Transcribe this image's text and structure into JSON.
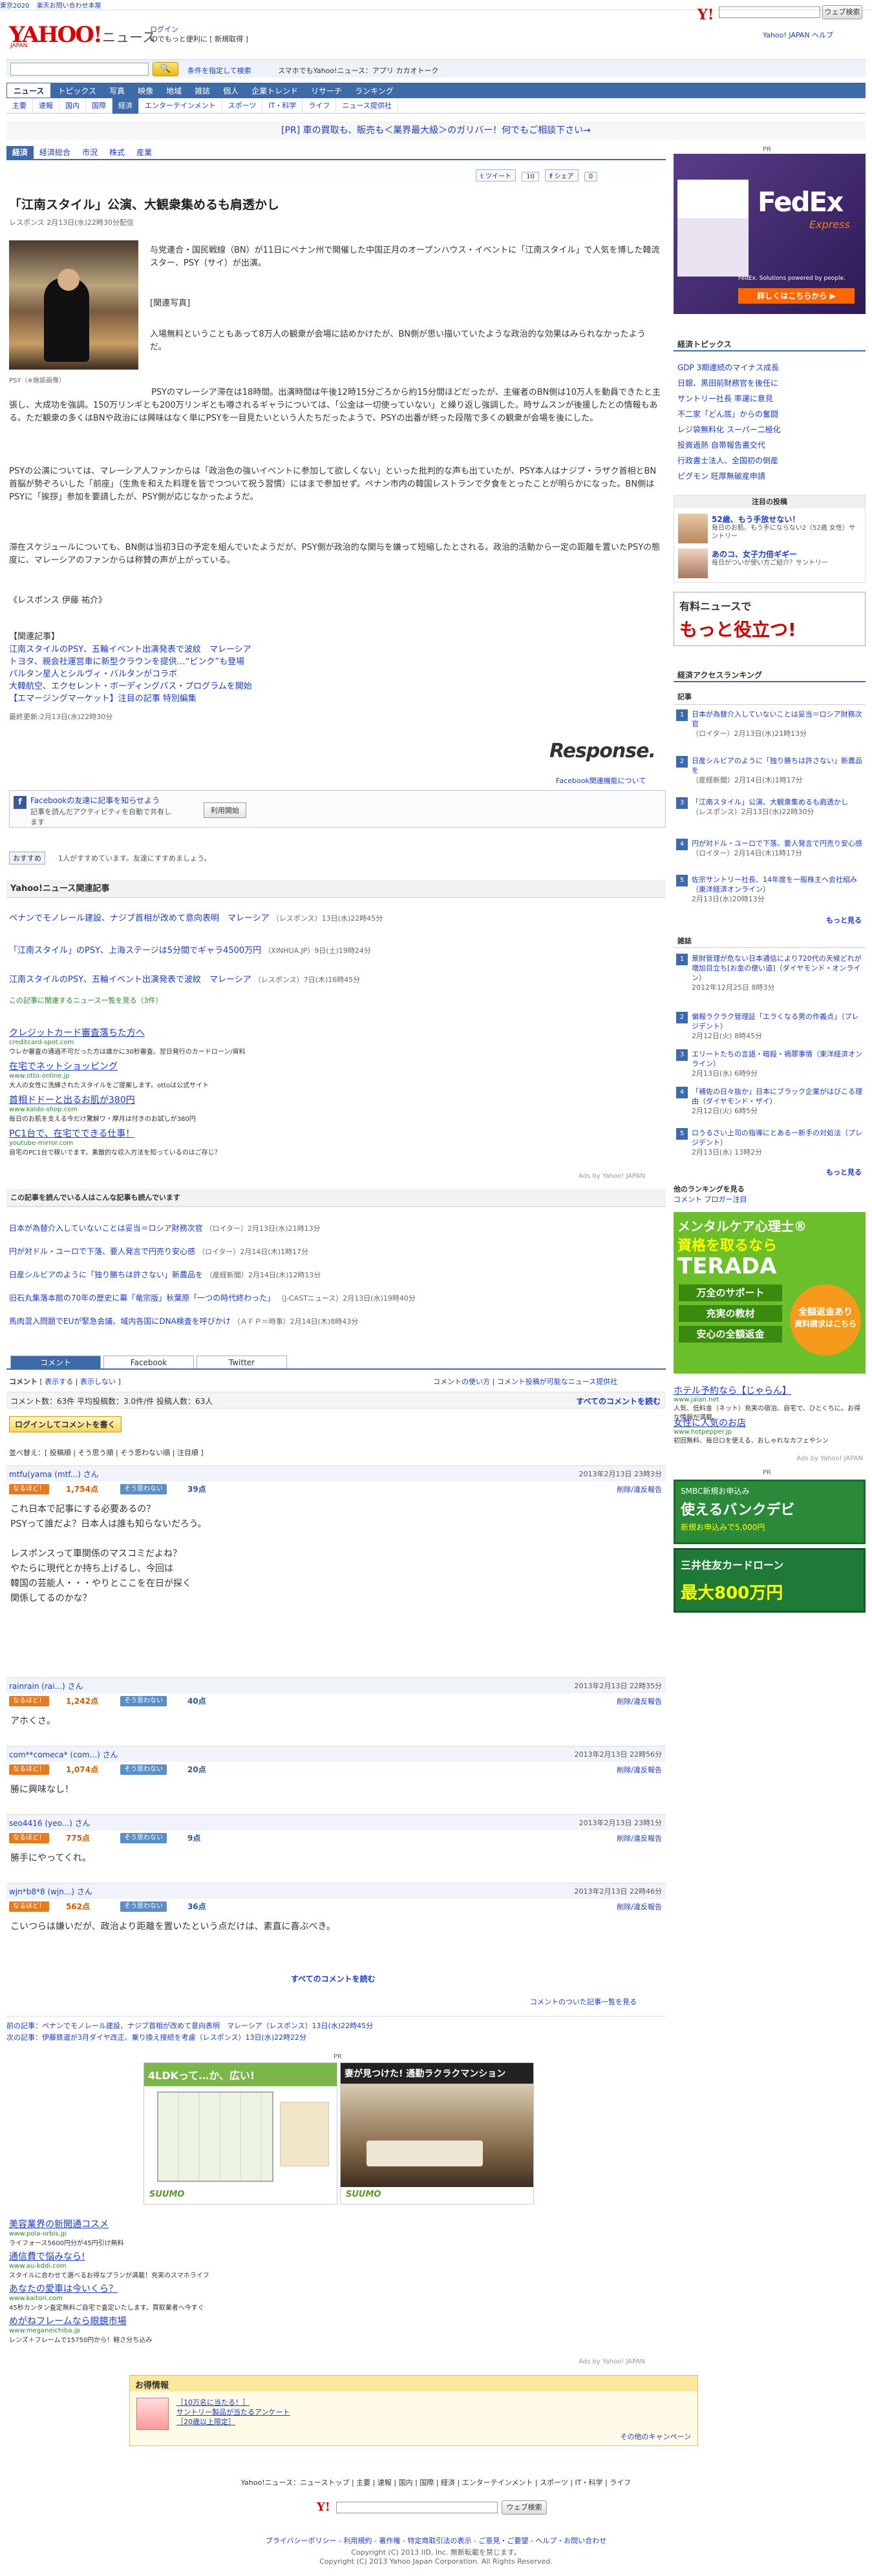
{
  "topbar": {
    "items": [
      "東京2020",
      "楽天お問い合わせ本屋",
      "ヤフオク!"
    ]
  },
  "header": {
    "logo": "YAHOO!",
    "logo_sub": "JAPAN",
    "section": "ニュース",
    "login": "ログイン",
    "login_sub": "IDでもっと便利に [ 新規取得 ]",
    "top_search_btn": "ウェブ検索",
    "top_links": "Yahoo! JAPAN ヘルプ"
  },
  "search": {
    "placeholder": "",
    "button": "🔍",
    "cond": "条件を指定して検索",
    "mobile": "スマホでもYahoo!ニュース：アプリ  カカオトーク"
  },
  "nav1": [
    "ニュース",
    "トピックス",
    "写真",
    "映像",
    "地域",
    "雑誌",
    "個人",
    "企業トレンド",
    "リサーチ",
    "ランキング"
  ],
  "nav2": [
    "主要",
    "速報",
    "国内",
    "国際",
    "経済",
    "エンターテインメント",
    "スポーツ",
    "IT・科学",
    "ライフ",
    "ニュース提供社"
  ],
  "pr_top": "[PR] 車の買取も、販売も＜業界最大級＞のガリバー！何でもご相談下さい→",
  "subnav": [
    "経済",
    "経済総合",
    "市況",
    "株式",
    "産業"
  ],
  "share": {
    "tweet": "ツイート",
    "tweet_count": "10",
    "fb": "シェア",
    "bookmark": "0"
  },
  "article": {
    "title": "「江南スタイル」公演、大観衆集めるも肩透かし",
    "meta": "レスポンス 2月13日(水)22時30分配信",
    "photo_caption": "PSY（※施設画像）",
    "p1": "与党連合・国民戦線（BN）が11日にペナン州で開催した中国正月のオープンハウス・イベントに「江南スタイル」で人気を博した韓流スター、PSY（サイ）が出演。",
    "related_photo": "[関連写真]",
    "p2": "入場無料ということもあって8万人の観衆が会場に詰めかけたが、BN側が思い描いていたような政治的な効果はみられなかったようだ。",
    "p3": "PSYのマレーシア滞在は18時間。出演時間は午後12時15分ごろから約15分間ほどだったが、主催者のBN側は10万人を動員できたと主張し、大成功を強調。150万リンギとも200万リンギとも噂されるギャラについては、「公金は一切使っていない」と繰り返し強調した。時サムスンが後援したとの情報もある。ただ観衆の多くはBNや政治には興味はなく単にPSYを一目見たいという人たちだったようで、PSYの出番が終った段階で多くの観衆が会場を後にした。",
    "p4": "PSYの公演については、マレーシア人ファンからは「政治色の強いイベントに参加して欲しくない」といった批判的な声も出ていたが、PSY本人はナジブ・ラザク首相とBN首脳が勢ぞろいした「前座」（生魚を和えた料理を皆でつついて祝う習慣）にはまで参加せず。ペナン市内の韓国レストランで夕食をとったことが明らかになった。BN側はPSYに「挨拶」参加を要請したが、PSY側が応じなかったようだ。",
    "p5": "滞在スケジュールについても、BN側は当初3日の予定を組んでいたようだが、PSY側が政治的な関与を嫌って短縮したとされる。政治的活動から一定の距離を置いたPSYの態度に、マレーシアのファンからは称賛の声が上がっている。",
    "author": "《レスポンス 伊藤 祐介》",
    "rel_head": "【関連記事】",
    "rel_links": [
      "江南スタイルのPSY、五輪イベント出演発表で波紋　マレーシア",
      "トヨタ、親会社運営車に新型クラウンを提供…“ピンク”も登場",
      "パルタン星人とシルヴィ・バルタンがコラボ",
      "大韓航空、エクセレント・ボーディングパス・プログラムを開始",
      "【エマージングマーケット】注目の記事 特別編集"
    ],
    "updated": "最終更新:2月13日(水)22時30分",
    "source_logo": "Response.",
    "fb_guide": "Facebook関連機能について",
    "fb_text": "Facebookの友達に記事を知らせよう",
    "fb_sub": "記事を読んだアクティビティを自動で共有します",
    "fb_btn": "利用開始",
    "like": "おすすめ",
    "like_note": "1人がすすめています。友達にすすめましょう。"
  },
  "related": {
    "head": "Yahoo!ニュース関連記事",
    "items": [
      {
        "t": "ペナンでモノレール建設、ナジブ首相が改めて意向表明　マレーシア",
        "s": "（レスポンス）13日(水)22時45分"
      },
      {
        "t": "「江南スタイル」のPSY、上海ステージは5分間でギャラ4500万円",
        "s": "（XINHUA.JP）9日(土)19時24分"
      },
      {
        "t": "江南スタイルのPSY、五輪イベント出演発表で波紋　マレーシア",
        "s": "（レスポンス）7日(木)16時45分"
      }
    ],
    "more": "この記事に関連するニュース一覧を見る（3件）"
  },
  "ads1": [
    {
      "t": "クレジットカード審査落ちた方へ",
      "u": "creditcard-spot.com",
      "d": "ウレか審査の通過不可だった方は誰かに30秒審査。翌日発行のカードローン/資料"
    },
    {
      "t": "在宅でネットショッピング",
      "u": "www.otto-online.jp",
      "d": "大人の女性に洗練されたスタイルをご提案します。ottoは公式サイト"
    },
    {
      "t": "首相ドドーと出るお肌が380円",
      "u": "www.kaldo-shop.com",
      "d": "毎日のお肌を支える今だけ驚解ワ・摩月は付きのお試しが380円"
    },
    {
      "t": "PC1台で、在宅でできる仕事！",
      "u": "youtube-mirror.com",
      "d": "自宅のPC1台で稼いでます。素敵的な収入方法を知っているのはご存じ？"
    }
  ],
  "ads1_label": "Ads by Yahoo! JAPAN",
  "others": {
    "head": "この記事を読んでいる人はこんな記事も読んでいます",
    "items": [
      {
        "t": "日本が為替介入していないことは妥当＝ロシア財務次官",
        "s": "（ロイター）2月13日(水)21時13分"
      },
      {
        "t": "円が対ドル・ユーロで下落、要人発言で円売り安心感",
        "s": "（ロイター）2月14日(木)1時17分"
      },
      {
        "t": "日産シルビアのように「独り勝ちは許さない」新農品を",
        "s": "（産経新聞）2月14日(木)12時13分"
      },
      {
        "t": "旧石丸集落本館の70年の歴史に幕「竜宗版」秋葉原「一つの時代終わった」",
        "s": "（J-CASTニュース）2月13日(水)19時40分"
      },
      {
        "t": "馬肉混入問題でEUが緊急会議、域内各国にDNA検査を呼びかけ",
        "s": "（ＡＦＰ＝時事）2月14日(木)8時43分"
      }
    ]
  },
  "tabs": [
    "コメント",
    "Facebook",
    "Twitter"
  ],
  "comments_bar": {
    "label": "コメント",
    "show": "表示する",
    "hide": "表示しない",
    "policy": "コメントの使い方",
    "policy2": "コメント投稿が可能なニュース提供社"
  },
  "stats": {
    "text": "コメント数：63件  平均投稿数：3.0件/件  投稿人数：63人",
    "all": "すべてのコメントを読む"
  },
  "login_btn": "ログインしてコメントを書く",
  "sort": "並べ替え：[ 投稿順 | そう思う順 | そう思わない順 | 注目順 ]",
  "comments": [
    {
      "name": "mtfu(yama (mtf...) さん",
      "date": "2013年2月13日 23時3分",
      "agree": "なるほど！",
      "agree_n": "1,754点",
      "dis": "そう思わない",
      "dis_n": "39点",
      "report": "削除/違反報告",
      "body": "これ日本で記事にする必要あるの？\nPSYって誰だよ？日本人は誰も知らないだろう。\n\nレスポンスって車関係のマスコミだよね？\nやたらに現代とか持ち上げるし、今回は\n韓国の芸能人・・・やりとここを在日が探く\n関係してるのかな？"
    },
    {
      "name": "rainrain (rai...) さん",
      "date": "2013年2月13日 22時35分",
      "agree": "なるほど！",
      "agree_n": "1,242点",
      "dis": "そう思わない",
      "dis_n": "40点",
      "report": "削除/違反報告",
      "body": "アホくさ。"
    },
    {
      "name": "com**comeca* (com...) さん",
      "date": "2013年2月13日 22時56分",
      "agree": "なるほど！",
      "agree_n": "1,074点",
      "dis": "そう思わない",
      "dis_n": "20点",
      "report": "削除/違反報告",
      "body": "勝に興味なし！"
    },
    {
      "name": "seo4416 (yeo...) さん",
      "date": "2013年2月13日 23時1分",
      "agree": "なるほど！",
      "agree_n": "775点",
      "dis": "そう思わない",
      "dis_n": "9点",
      "report": "削除/違反報告",
      "body": "勝手にやってくれ。"
    },
    {
      "name": "wjn*b8*8 (wjn...) さん",
      "date": "2013年2月13日 22時46分",
      "agree": "なるほど！",
      "agree_n": "562点",
      "dis": "そう思わない",
      "dis_n": "36点",
      "report": "削除/違反報告",
      "body": "こいつらは嫌いだが、政治より距離を置いたという点だけは、素直に喜ぶべき。"
    }
  ],
  "all_comments": "すべてのコメントを読む",
  "comment_ranking": "コメントのついた記事一覧を見る",
  "prevnext": {
    "prev": "前の記事：ペナンでモノレール建設、ナジブ首相が改めて意向表明　マレーシア（レスポンス）13日(水)22時45分",
    "next": "次の記事：伊藤鉄道が3月ダイヤ改正、乗り換え接続を考慮（レスポンス）13日(水)22時22分"
  },
  "pr_mid": "PR",
  "house_ads": [
    {
      "t": "4LDKって…か、広い!"
    },
    {
      "t": "妻が見つけた! 通勤ラクラクマンション"
    }
  ],
  "house_brand": "SUUMO",
  "ads2": [
    {
      "t": "美容業界の新開通コスメ",
      "u": "www.pola-orbis.jp",
      "d": "ライフォース5600円分が45円引け無料"
    },
    {
      "t": "通信費で悩みなら!",
      "u": "www.au-kddi.com",
      "d": "スタイルに合わせて選べるお得なプランが満載！充実のスマホライフ"
    },
    {
      "t": "あなたの愛車は今いくら？",
      "u": "www.kaitori.com",
      "d": "45秒カンタン査定無料ご自宅で査定いたします。買取業者へ今すぐ"
    },
    {
      "t": "めがねフレームなら眼鏡市場",
      "u": "www.meganeichiba.jp",
      "d": "レンズ＋フレームで15750円から！軽さ分ち込み"
    }
  ],
  "ads2_label": "Ads by Yahoo! JAPAN",
  "otoku": {
    "head": "お得情報",
    "l1": "［10万名に当たる！］",
    "l2": "サントリー製品が当たるアンケート",
    "l3": "［20歳以上限定］",
    "more": "その他のキャンペーン"
  },
  "footer_nav": "Yahoo!ニュース：ニューストップ | 主要 | 速報 | 国内 | 国際 | 経済 | エンターテインメント | スポーツ | IT・科学 | ライフ",
  "footer_search_btn": "ウェブ検索",
  "footer_links": "プライバシーポリシー - 利用規約 - 著作権 - 特定商取引法の表示 - ご意見・ご要望 - ヘルプ・お問い合わせ",
  "copyright1": "Copyright (C) 2013 IID, Inc. 無断転載を禁じます。",
  "copyright2": "Copyright (C) 2013 Yahoo Japan Corporation. All Rights Reserved.",
  "right": {
    "pr": "PR",
    "fedex": "FedEx",
    "fedex_sub": "Express",
    "fedex_tag": "FedEx. Solutions powered by people.",
    "fedex_btn": "詳しくはこちらから ▶",
    "topics_head": "経済トピックス",
    "topics": [
      "GDP 3期連続のマイナス成長",
      "日銀、黒田前財務官を後任に",
      "サントリー社長 率運に意見",
      "不二家「どん底」からの奮闘",
      "レジ袋無料化 スーパー二極化",
      "投資過熱 自帯報告書交代",
      "行政書士法人、全国初の倒産",
      "ピグモン 旺厚無破産申請"
    ],
    "talent_head": "注目の投稿",
    "talent": [
      {
        "t": "52歳、もう手放せない！",
        "d": "毎日のお肌、もう手にならない2（52歳 女性）サントリー"
      },
      {
        "t": "あのコ、女子力倍ギギー",
        "d": "毎日がついが使い方ご紹介？サントリー"
      }
    ],
    "ad2_l1": "有料ニュースで",
    "ad2_l2": "もっと役立つ!",
    "access_head": "経済アクセスランキング",
    "access_tab": "記事",
    "access": [
      {
        "t": "日本が為替介入していないことは妥当＝ロシア財務次官",
        "s": "（ロイター）2月13日(水)21時13分"
      },
      {
        "t": "日産シルビアのように「独り勝ちは許さない」新農品を",
        "s": "（産経新聞）2月14日(木)1時17分"
      },
      {
        "t": "「江南スタイル」公演、大観衆集めるも肩透かし",
        "s": "（レスポンス）2月13日(水)22時30分"
      },
      {
        "t": "円が対ドル・ユーロで下落、要人発言で円売り安心感",
        "s": "（ロイター）2月14日(木)1時17分"
      },
      {
        "t": "佐宗サントリー社長、14年度を一般株主へ会社組み（東洋経済オンライン）",
        "s": "2月13日(水)20時13分"
      }
    ],
    "more1": "もっと見る",
    "mag_tab": "雑誌",
    "mags": [
      {
        "t": "景財管理が危ない日本通信により720代の天候どれが増加目立ち[お金の使い道]（ダイヤモンド・オンライン）",
        "s": "2012年12月25日 8時3分"
      },
      {
        "t": "偏報ラクラク管理証「エラくなる男の作義点」（プレジデント）",
        "s": "2月12日(火) 8時45分"
      },
      {
        "t": "エリートたちの言語・暗殺・禍罪事情（東洋経済オンライン）",
        "s": "2月13日(水) 6時9分"
      },
      {
        "t": "「補佐の日々抜か」日本にブラック企業がはびこる理由（ダイヤモンド・ザイ）",
        "s": "2月12日(火) 6時5分"
      },
      {
        "t": "ロうるさい上司の指導にとある一新手の対処法（プレジデント）",
        "s": "2月13日(水) 13時2分"
      }
    ],
    "more2": "もっと見る",
    "other_rank": "他のランキングを見る",
    "other_rank_sub": "コメント  ブロガー注目",
    "terada_l1": "メンタルケア心理士®",
    "terada_l2": "資格を取るなら",
    "terada_l3": "TERADA",
    "terada_b1": "万全のサポート",
    "terada_b2": "充実の教材",
    "terada_b3": "安心の全額返金",
    "terada_b4": "全額返金あり",
    "terada_btn": "資料請求はこちら",
    "hotel_t": "ホテル予約なら【じゃらん】",
    "hotel_u": "www.jalan.net",
    "hotel_d": "人気、低料金（ネット）充実の宿泊、自宅で、ひとくちに。お得な情報が満載。",
    "woman_t": "女性に人気のお店",
    "woman_u": "www.hotpepper.jp",
    "woman_d": "初回無料、毎日ロを使える、おしゃれなカフェやシン",
    "ads_label": "Ads by Yahoo! JAPAN",
    "pr2": "PR",
    "bank_l1": "SMBC新規お申込み",
    "bank_l2": "使えるバンクデビ",
    "bank_l3": "新規お申込みで5,000円",
    "card_l1": "三井住友カードローン",
    "card_l2": "最大800万円"
  }
}
